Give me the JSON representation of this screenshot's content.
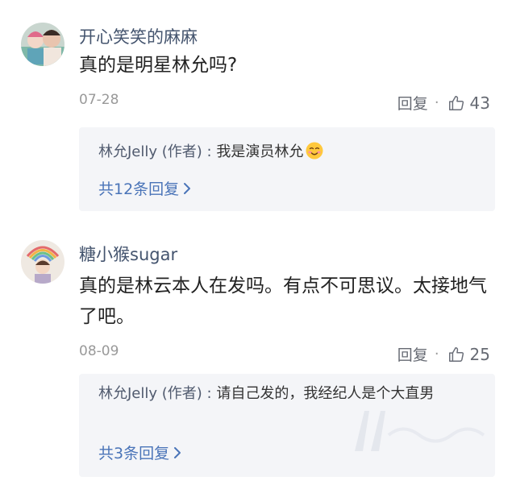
{
  "comments": [
    {
      "username": "开心笑笑的麻麻",
      "text": "真的是明星林允吗?",
      "date": "07-28",
      "reply_label": "回复",
      "separator": "·",
      "likes": "43",
      "reply": {
        "author": "林允Jelly (作者)",
        "colon": " : ",
        "text": "我是演员林允",
        "more": "共12条回复"
      }
    },
    {
      "username": "糖小猴sugar",
      "text": "真的是林云本人在发吗。有点不可思议。太接地气了吧。",
      "date": "08-09",
      "reply_label": "回复",
      "separator": "·",
      "likes": "25",
      "reply": {
        "author": "林允Jelly (作者)",
        "colon": " : ",
        "text": "请自己发的，我经纪人是个大直男",
        "more": "共3条回复"
      }
    }
  ],
  "colors": {
    "username": "#44546e",
    "body": "#222222",
    "meta": "#999999",
    "reply_bg": "#f4f5f8",
    "link": "#4a74b8"
  },
  "icons": {
    "like": "thumbs-up-outline-icon",
    "chevron": "chevron-right-icon",
    "emoji": "smiling-face-icon"
  }
}
